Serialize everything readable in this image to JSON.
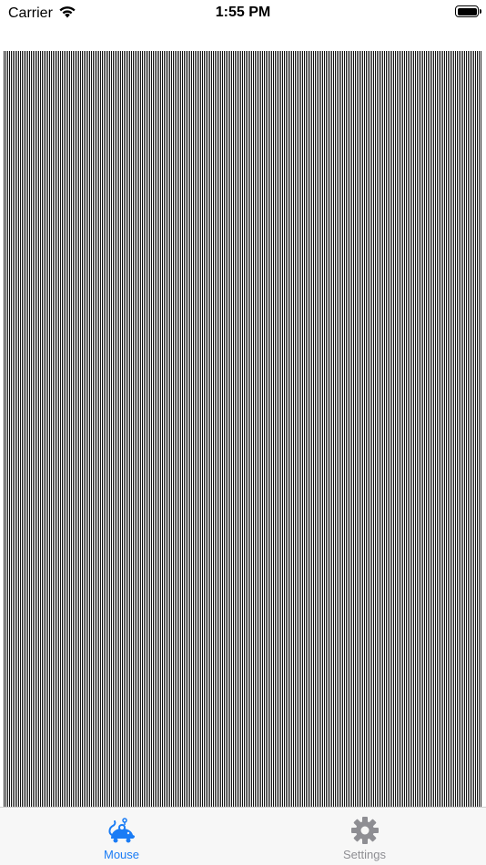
{
  "status_bar": {
    "carrier": "Carrier",
    "time": "1:55 PM",
    "wifi_icon": "wifi-icon",
    "battery_icon": "battery-icon"
  },
  "trackpad": {
    "pattern": "vertical-stripes"
  },
  "tab_bar": {
    "tabs": [
      {
        "label": "Mouse",
        "icon": "mouse-icon",
        "active": true
      },
      {
        "label": "Settings",
        "icon": "gear-icon",
        "active": false
      }
    ]
  },
  "colors": {
    "accent": "#1a7cf5",
    "inactive": "#8e8e93",
    "tab_bar_bg": "#f7f7f7"
  }
}
